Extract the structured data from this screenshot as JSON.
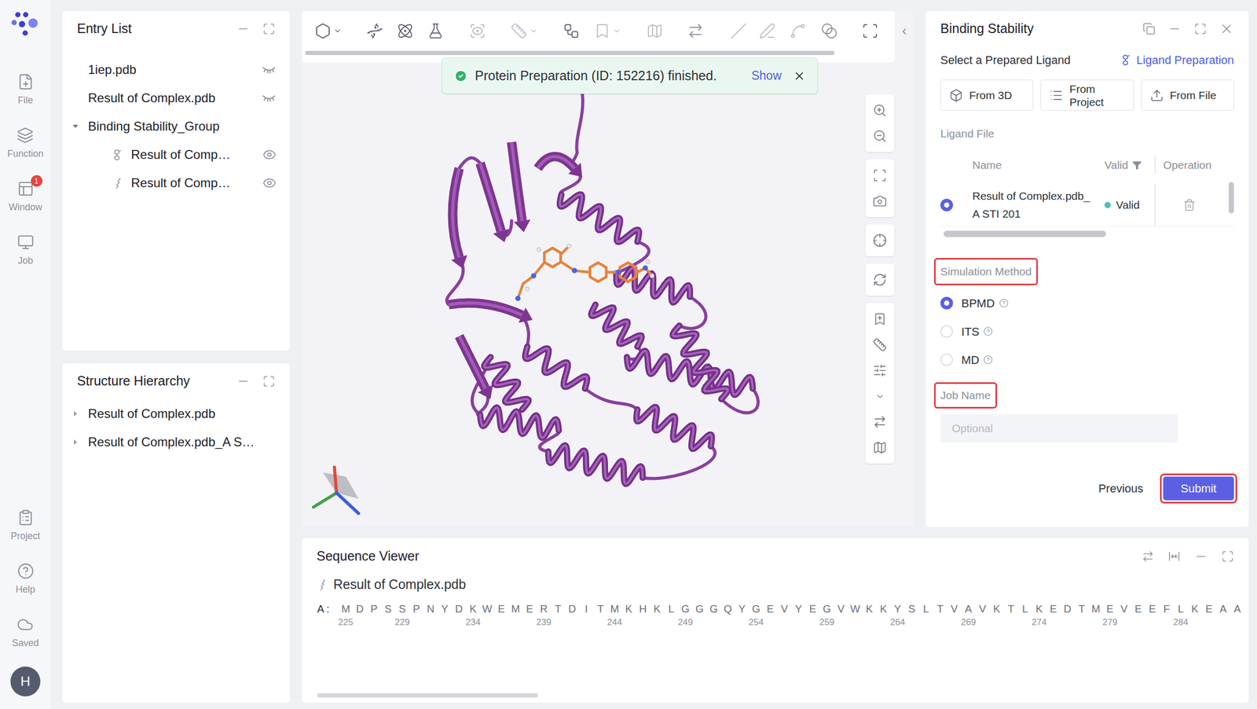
{
  "nav": {
    "items": [
      {
        "label": "File"
      },
      {
        "label": "Function"
      },
      {
        "label": "Window",
        "badge": "1"
      },
      {
        "label": "Job"
      }
    ],
    "bottom": [
      {
        "label": "Project"
      },
      {
        "label": "Help"
      },
      {
        "label": "Saved"
      }
    ],
    "avatar": "H"
  },
  "entry_list": {
    "title": "Entry List",
    "items": [
      {
        "name": "1iep.pdb",
        "kind": "file",
        "depth": 0,
        "visible": false
      },
      {
        "name": "Result of Complex.pdb",
        "kind": "file",
        "depth": 0,
        "visible": false
      },
      {
        "name": "Binding Stability_Group",
        "kind": "group",
        "depth": 0,
        "expanded": true
      },
      {
        "name": "Result of Comp…",
        "kind": "ligand",
        "depth": 1,
        "visible": true
      },
      {
        "name": "Result of Comp…",
        "kind": "protein",
        "depth": 1,
        "visible": true
      }
    ]
  },
  "structure_hierarchy": {
    "title": "Structure Hierarchy",
    "items": [
      {
        "name": "Result of Complex.pdb",
        "expanded": false
      },
      {
        "name": "Result of Complex.pdb_A S…",
        "expanded": false
      }
    ]
  },
  "toast": {
    "message": "Protein Preparation (ID: 152216) finished.",
    "action": "Show"
  },
  "binding_panel": {
    "title": "Binding Stability",
    "section": "Select a Prepared Ligand",
    "link": "Ligand Preparation",
    "sources": [
      "From 3D",
      "From Project",
      "From File"
    ],
    "ligand_file_label": "Ligand File",
    "table": {
      "columns": [
        "Name",
        "Valid",
        "Operation"
      ],
      "rows": [
        {
          "name": "Result of Complex.pdb_A STI 201",
          "valid": "Valid",
          "color": "#4cc3b3",
          "selected": true
        }
      ]
    },
    "method_label": {
      "text": "Simulation Method",
      "highlighted": true
    },
    "methods": [
      {
        "label": "BPMD",
        "selected": true
      },
      {
        "label": "ITS",
        "selected": false
      },
      {
        "label": "MD",
        "selected": false
      }
    ],
    "job_name_label": {
      "text": "Job Name",
      "highlighted": true
    },
    "job_name_placeholder": "Optional",
    "previous": "Previous",
    "submit": {
      "text": "Submit",
      "highlighted": true
    }
  },
  "sequence_viewer": {
    "title": "Sequence Viewer",
    "entry": "Result of Complex.pdb",
    "chain": "A :",
    "residues": [
      {
        "aa": "M",
        "num": "225"
      },
      {
        "aa": "D"
      },
      {
        "aa": "P"
      },
      {
        "aa": "S"
      },
      {
        "aa": "S",
        "num": "229"
      },
      {
        "aa": "P"
      },
      {
        "aa": "N"
      },
      {
        "aa": "Y"
      },
      {
        "aa": "D"
      },
      {
        "aa": "K",
        "num": "234"
      },
      {
        "aa": "W"
      },
      {
        "aa": "E"
      },
      {
        "aa": "M"
      },
      {
        "aa": "E"
      },
      {
        "aa": "R",
        "num": "239"
      },
      {
        "aa": "T"
      },
      {
        "aa": "D"
      },
      {
        "aa": "I"
      },
      {
        "aa": "T"
      },
      {
        "aa": "M",
        "num": "244"
      },
      {
        "aa": "K"
      },
      {
        "aa": "H"
      },
      {
        "aa": "K"
      },
      {
        "aa": "L"
      },
      {
        "aa": "G",
        "num": "249"
      },
      {
        "aa": "G"
      },
      {
        "aa": "G"
      },
      {
        "aa": "Q"
      },
      {
        "aa": "Y"
      },
      {
        "aa": "G",
        "num": "254"
      },
      {
        "aa": "E"
      },
      {
        "aa": "V"
      },
      {
        "aa": "Y"
      },
      {
        "aa": "E"
      },
      {
        "aa": "G",
        "num": "259"
      },
      {
        "aa": "V"
      },
      {
        "aa": "W"
      },
      {
        "aa": "K"
      },
      {
        "aa": "K"
      },
      {
        "aa": "Y",
        "num": "264"
      },
      {
        "aa": "S"
      },
      {
        "aa": "L"
      },
      {
        "aa": "T"
      },
      {
        "aa": "V"
      },
      {
        "aa": "A",
        "num": "269"
      },
      {
        "aa": "V"
      },
      {
        "aa": "K"
      },
      {
        "aa": "T"
      },
      {
        "aa": "L"
      },
      {
        "aa": "K",
        "num": "274"
      },
      {
        "aa": "E"
      },
      {
        "aa": "D"
      },
      {
        "aa": "T"
      },
      {
        "aa": "M"
      },
      {
        "aa": "E",
        "num": "279"
      },
      {
        "aa": "V"
      },
      {
        "aa": "E"
      },
      {
        "aa": "E"
      },
      {
        "aa": "F"
      },
      {
        "aa": "L",
        "num": "284"
      },
      {
        "aa": "K"
      },
      {
        "aa": "E"
      },
      {
        "aa": "A"
      },
      {
        "aa": "A"
      }
    ]
  }
}
